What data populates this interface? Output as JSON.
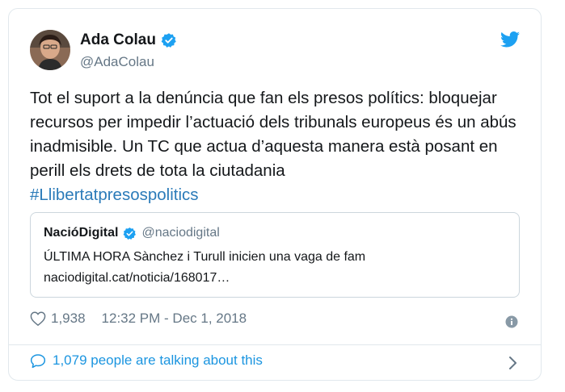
{
  "tweet": {
    "author": {
      "display_name": "Ada Colau",
      "handle": "@AdaColau",
      "verified": true
    },
    "text_main": "Tot el suport a la denúncia que fan els presos polítics: bloquejar recursos per impedir l’actuació dels tribunals europeus és un abús inadmisible. Un TC que actua d’aquesta manera està posant en perill els drets de tota la ciutadania",
    "hashtag": "#Llibertatpresospolitics",
    "quote": {
      "display_name": "NacióDigital",
      "handle": "@naciodigital",
      "verified": true,
      "text": "ÚLTIMA HORA Sànchez i Turull inicien una vaga de fam",
      "link": "naciodigital.cat/noticia/168017…"
    },
    "likes": "1,938",
    "timestamp": "12:32 PM - Dec 1, 2018",
    "talking": "1,079 people are talking about this"
  },
  "colors": {
    "twitter_blue": "#1da1f2",
    "link_blue": "#1b95e0",
    "hashtag_blue": "#2b7bb9",
    "text": "#14171a",
    "muted": "#657786"
  },
  "icons": {
    "verified": "verified-badge-icon",
    "bird": "twitter-bird-icon",
    "like": "heart-icon",
    "info": "info-icon",
    "reply": "speech-bubble-icon",
    "chevron": "chevron-right-icon"
  }
}
